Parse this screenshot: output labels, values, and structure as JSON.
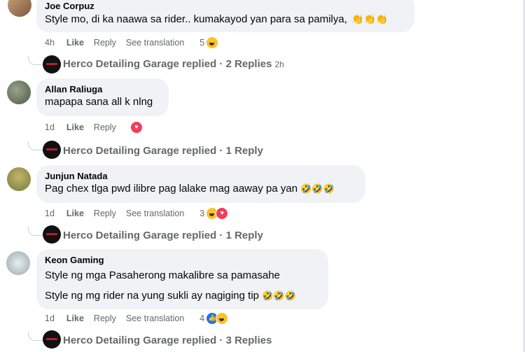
{
  "actions": {
    "like": "Like",
    "reply": "Reply",
    "see_translation": "See translation"
  },
  "reply_author": "Herco Detailing Garage",
  "comments": [
    {
      "author": "Joe Corpuz",
      "text": "Style mo, di ka naawa sa rider.. kumakayod yan para sa pamilya,",
      "emoji_suffix": "👏👏👏",
      "time": "4h",
      "reaction_count": "5",
      "reactions": [
        "haha"
      ],
      "replies_text": "replied · 2 Replies",
      "replies_time": "2h"
    },
    {
      "author": "Allan Raliuga",
      "text": "mapapa sana all k nlng",
      "time": "1d",
      "reaction_count": "",
      "reactions": [
        "love"
      ],
      "replies_text": "replied · 1 Reply"
    },
    {
      "author": "Junjun Natada",
      "text": "Pag chex tlga pwd ilibre pag lalake mag aaway pa yan",
      "emoji_suffix": "🤣🤣🤣",
      "time": "1d",
      "reaction_count": "3",
      "reactions": [
        "haha",
        "love"
      ],
      "replies_text": "replied · 1 Reply"
    },
    {
      "author": "Keon Gaming",
      "text_line1": "Style ng mga Pasaherong makalibre sa pamasahe",
      "text_line2": "Style ng mg rider na yung sukli ay nagiging tip",
      "emoji_suffix": "🤣🤣🤣",
      "time": "1d",
      "reaction_count": "4",
      "reactions": [
        "like",
        "haha"
      ],
      "replies_text": "replied · 3 Replies"
    }
  ],
  "colors": {
    "bubble": "#f0f2f5",
    "meta": "#65676b",
    "like_blue": "#1877f2",
    "love_red": "#f33e58",
    "haha_yellow": "#f7c32e"
  }
}
